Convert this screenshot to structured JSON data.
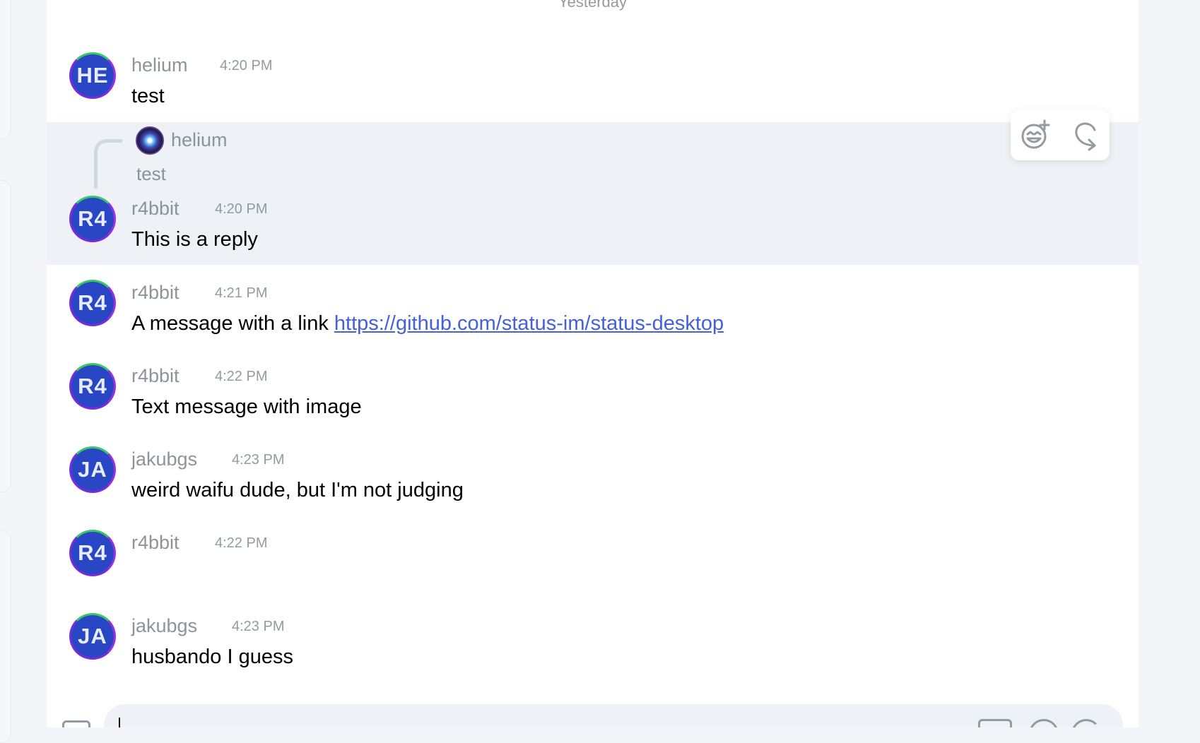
{
  "day_separator": "Yesterday",
  "reply": {
    "quoted_author": "helium",
    "quoted_text": "test"
  },
  "messages": [
    {
      "initials": "HE",
      "author": "helium",
      "time": "4:20 PM",
      "text": "test"
    },
    {
      "initials": "R4",
      "author": "r4bbit",
      "time": "4:20 PM",
      "text": "This is a reply"
    },
    {
      "initials": "R4",
      "author": "r4bbit",
      "time": "4:21 PM",
      "text": "A message with a link ",
      "link": "https://github.com/status-im/status-desktop"
    },
    {
      "initials": "R4",
      "author": "r4bbit",
      "time": "4:22 PM",
      "text": "Text message with image"
    },
    {
      "initials": "JA",
      "author": "jakubgs",
      "time": "4:23 PM",
      "text": "weird waifu dude, but I'm not judging"
    },
    {
      "initials": "R4",
      "author": "r4bbit",
      "time": "4:22 PM",
      "text": ""
    },
    {
      "initials": "JA",
      "author": "jakubgs",
      "time": "4:23 PM",
      "text": "husbando I guess"
    }
  ],
  "hover_actions": [
    {
      "icon": "add-reaction-icon"
    },
    {
      "icon": "reply-icon"
    }
  ],
  "colors": {
    "avatar_bg": "#2946c4",
    "link": "#4360df",
    "highlight_bg": "#eef1f5",
    "meta_text": "#939ba1"
  }
}
